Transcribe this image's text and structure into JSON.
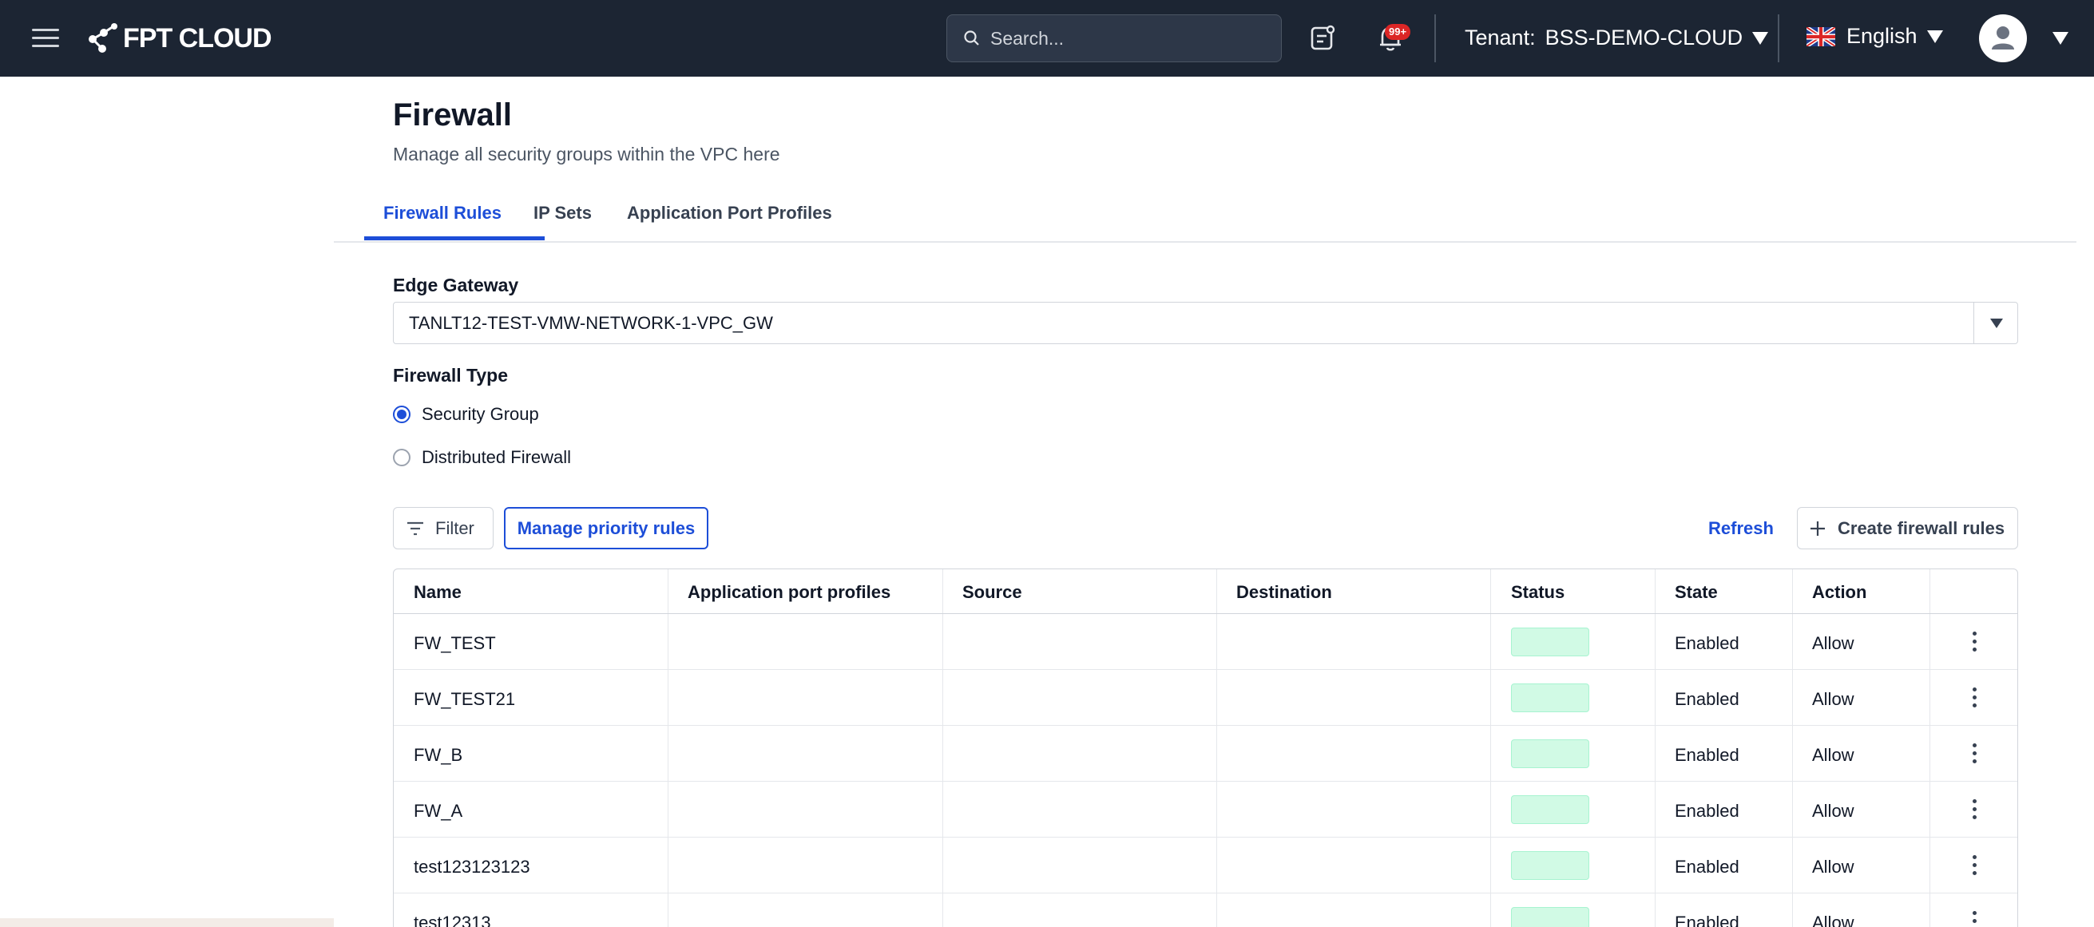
{
  "header": {
    "brand": "FPT CLOUD",
    "search_placeholder": "Search...",
    "notification_badge": "99+",
    "tenant_label": "Tenant:",
    "tenant_value": "BSS-DEMO-CLOUD",
    "language": "English"
  },
  "page": {
    "title": "Firewall",
    "subtitle": "Manage all security groups within the VPC here"
  },
  "tabs": [
    {
      "label": "Firewall Rules",
      "active": true
    },
    {
      "label": "IP Sets",
      "active": false
    },
    {
      "label": "Application Port Profiles",
      "active": false
    }
  ],
  "form": {
    "edge_gateway_label": "Edge Gateway",
    "edge_gateway_value": "TANLT12-TEST-VMW-NETWORK-1-VPC_GW",
    "firewall_type_label": "Firewall Type",
    "options": [
      {
        "label": "Security Group",
        "checked": true
      },
      {
        "label": "Distributed Firewall",
        "checked": false
      }
    ]
  },
  "toolbar": {
    "filter_label": "Filter",
    "manage_priority_label": "Manage priority rules",
    "refresh_label": "Refresh",
    "create_label": "Create firewall rules"
  },
  "table": {
    "columns": [
      "Name",
      "Application port profiles",
      "Source",
      "Destination",
      "Status",
      "State",
      "Action"
    ],
    "rows": [
      {
        "name": "FW_TEST",
        "app_profiles": "",
        "source": "",
        "destination": "",
        "state": "Enabled",
        "action": "Allow"
      },
      {
        "name": "FW_TEST21",
        "app_profiles": "",
        "source": "",
        "destination": "",
        "state": "Enabled",
        "action": "Allow"
      },
      {
        "name": "FW_B",
        "app_profiles": "",
        "source": "",
        "destination": "",
        "state": "Enabled",
        "action": "Allow"
      },
      {
        "name": "FW_A",
        "app_profiles": "",
        "source": "",
        "destination": "",
        "state": "Enabled",
        "action": "Allow"
      },
      {
        "name": "test123123123",
        "app_profiles": "",
        "source": "",
        "destination": "",
        "state": "Enabled",
        "action": "Allow"
      },
      {
        "name": "test12313",
        "app_profiles": "",
        "source": "",
        "destination": "",
        "state": "Enabled",
        "action": "Allow"
      }
    ]
  },
  "colors": {
    "topbar": "#1c2533",
    "accent": "#1d4ed8",
    "status_fill": "#d1fae5",
    "badge": "#dc2626"
  }
}
